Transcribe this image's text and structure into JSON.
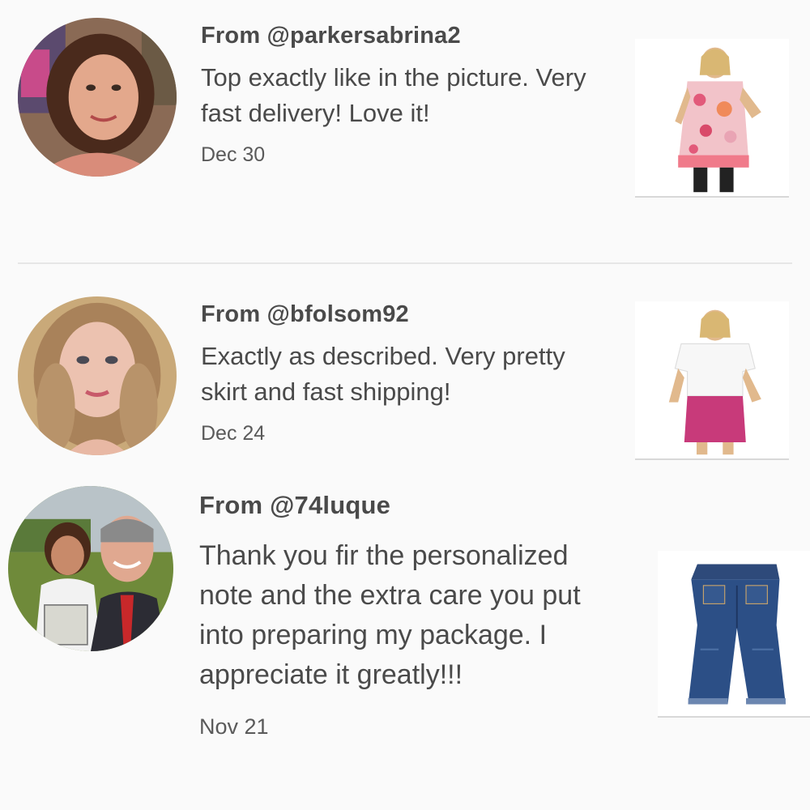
{
  "reviews": [
    {
      "username": "From @parkersabrina2",
      "comment": "Top exactly like in the picture. Very fast delivery! Love it!",
      "date": "Dec 30",
      "avatar_icon": "reviewer-avatar-photo",
      "product_icon": "floral-top-product-photo"
    },
    {
      "username": "From @bfolsom92",
      "comment": "Exactly as described. Very pretty skirt and fast shipping!",
      "date": "Dec 24",
      "avatar_icon": "reviewer-avatar-photo",
      "product_icon": "pink-skirt-product-photo"
    },
    {
      "username": "From @74luque",
      "comment": "Thank you fir the personalized note and the extra care you put into preparing my package. I appreciate it greatly!!!",
      "date": "Nov 21",
      "avatar_icon": "reviewer-avatar-photo",
      "product_icon": "jeans-product-photo"
    }
  ],
  "colors": {
    "background": "#fafafa",
    "text": "#4a4a4a",
    "divider": "#e6e6e6"
  }
}
